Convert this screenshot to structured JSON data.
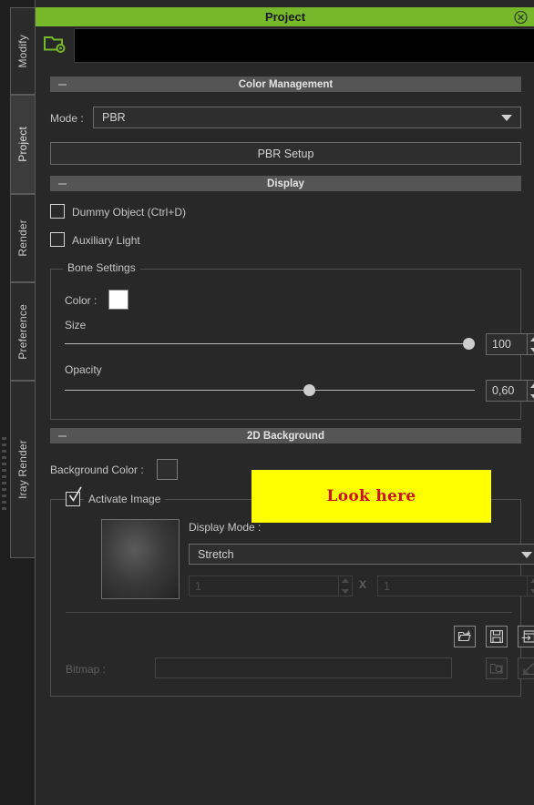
{
  "window": {
    "title": "Project",
    "close_icon": "close-circle-icon",
    "object_icon": "folder-gear-icon",
    "object_field_value": ""
  },
  "sidebar": {
    "tabs": [
      {
        "label": "Modify",
        "active": false
      },
      {
        "label": "Project",
        "active": true
      },
      {
        "label": "Render",
        "active": false
      },
      {
        "label": "Preference",
        "active": false
      },
      {
        "label": "Iray Render",
        "active": false
      }
    ]
  },
  "sections": {
    "color_management": {
      "title": "Color Management",
      "collapse_icon": "minus-icon",
      "mode_label": "Mode :",
      "mode_value": "PBR",
      "mode_dropdown_icon": "chevron-down-icon",
      "pbr_setup_label": "PBR Setup"
    },
    "display": {
      "title": "Display",
      "collapse_icon": "minus-icon",
      "dummy_object_label": "Dummy Object (Ctrl+D)",
      "dummy_object_checked": false,
      "auxiliary_light_label": "Auxiliary Light",
      "auxiliary_light_checked": false,
      "bone_settings": {
        "title": "Bone Settings",
        "color_label": "Color :",
        "color_value": "#ffffff",
        "size_label": "Size",
        "size_value": "100",
        "size_percent": 100,
        "opacity_label": "Opacity",
        "opacity_value": "0,60",
        "opacity_percent": 60
      }
    },
    "background_2d": {
      "title": "2D Background",
      "collapse_icon": "minus-icon",
      "background_color_label": "Background Color :",
      "background_color_value": "#2d2d2d",
      "activate_image_label": "Activate Image",
      "activate_image_checked": true,
      "thumbnail_name": "background-image-thumbnail",
      "display_mode_label": "Display Mode :",
      "display_mode_value": "Stretch",
      "display_mode_dropdown_icon": "chevron-down-icon",
      "tile_x_value": "1",
      "tile_separator": "X",
      "tile_y_value": "1",
      "toolbar_icons": [
        {
          "name": "load-image-icon",
          "enabled": true
        },
        {
          "name": "save-image-icon",
          "enabled": true
        },
        {
          "name": "import-image-icon",
          "enabled": true
        }
      ],
      "bitmap_label": "Bitmap :",
      "bitmap_value": "",
      "bitmap_icons": [
        {
          "name": "browse-bitmap-icon",
          "enabled": false
        },
        {
          "name": "apply-bitmap-icon",
          "enabled": false
        }
      ]
    }
  },
  "annotation": {
    "text": "Look here",
    "background_color": "#ffff00",
    "text_color": "#cc1111"
  },
  "colors": {
    "accent_green": "#76b82a",
    "panel_background": "#282828",
    "section_header": "#555555"
  }
}
